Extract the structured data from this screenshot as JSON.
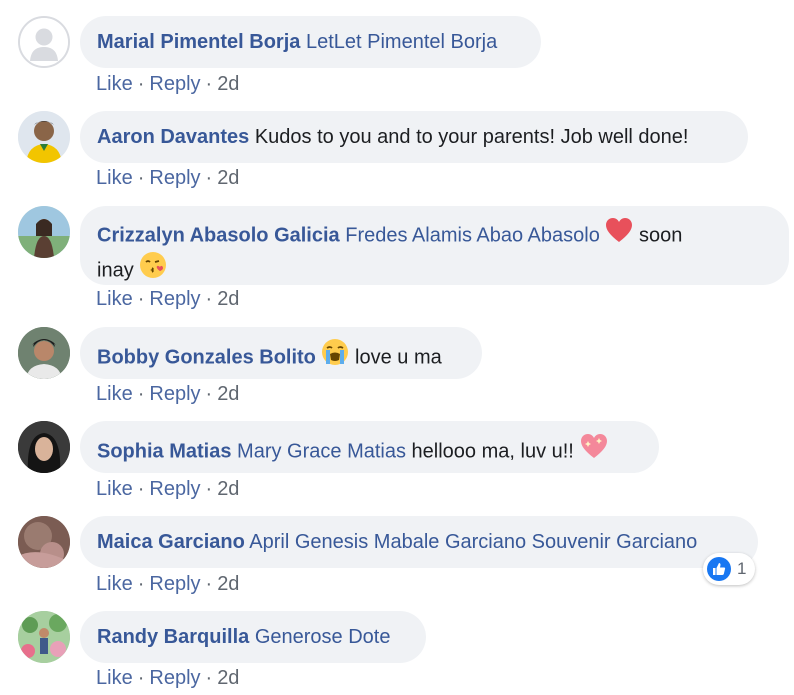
{
  "colors": {
    "author": "#385898",
    "link": "#4b67a1",
    "bubble": "#f0f2f5",
    "meta": "#606770",
    "like_blue": "#1877f2"
  },
  "actions": {
    "like": "Like",
    "reply": "Reply",
    "sep": "·",
    "time": "2d"
  },
  "comments": [
    {
      "author": "Marial Pimentel Borja",
      "mentions": [
        "LetLet Pimentel Borja"
      ],
      "text": ""
    },
    {
      "author": "Aaron Davantes",
      "mentions": [],
      "text": "Kudos to you and to your parents! Job well done!"
    },
    {
      "author": "Crizzalyn Abasolo Galicia",
      "mentions": [
        "Fredes Alamis Abao Abasolo"
      ],
      "text_after_heart": "soon",
      "text_line2": "inay",
      "emojis": [
        "heart-emoji",
        "kissing-face-emoji"
      ]
    },
    {
      "author": "Bobby Gonzales Bolito",
      "mentions": [],
      "text": "love u ma",
      "emojis": [
        "loudly-crying-face-emoji"
      ]
    },
    {
      "author": "Sophia Matias",
      "mentions": [
        "Mary Grace Matias"
      ],
      "text": "hellooo ma, luv u!!",
      "emojis": [
        "sparkling-heart-emoji"
      ]
    },
    {
      "author": "Maica Garciano",
      "mentions": [
        "April Genesis Mabale Garciano",
        "Souvenir Garciano"
      ],
      "text": "",
      "reaction_count": "1",
      "reaction_icon": "thumbs-up-icon"
    },
    {
      "author": "Randy Barquilla",
      "mentions": [
        "Generose Dote"
      ],
      "text": ""
    }
  ]
}
